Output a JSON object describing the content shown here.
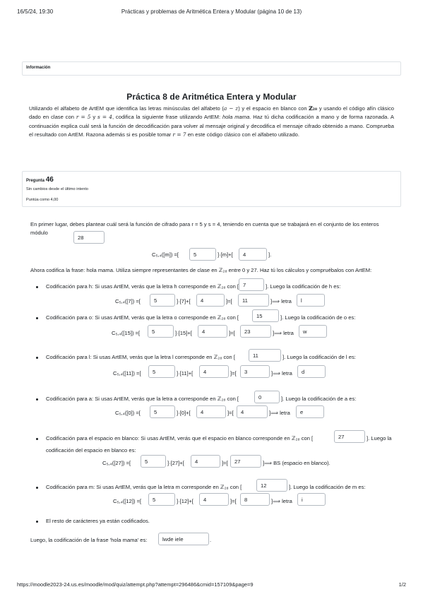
{
  "print_header": {
    "date": "16/5/24, 19:30",
    "title": "Prácticas y problemas de Aritmética Entera y Modular (página 10 de 13)"
  },
  "info": {
    "label": "Información"
  },
  "practice": {
    "title": "Práctica 8 de Aritmética Entera y Modular",
    "intro": [
      "Utilizando el alfabeto de ArtEM que identifica las letras minúsculas del alfabeto (",
      "a − z",
      ") y el espacio en blanco con ",
      "ℤ₂₈",
      " y usando el código afín clásico dado en clase con ",
      "r = 5",
      " y ",
      "s = 4",
      ", codifica la siguiente frase utilizando ArtEM: ",
      "hola mama",
      ". Haz tú dicha codificación a mano y de forma razonada. A continuación explica cuál será la función de decodificación para volver al mensaje original y decodifica el mensaje cifrado obtenido a mano. Comprueba el resultado con ArtEM. Razona además si es posible tomar ",
      "r = 7",
      " en este código clásico con el alfabeto utilizado."
    ]
  },
  "question": {
    "label": "Pregunta",
    "number": "46",
    "state": "Sin cambios desde el último intento",
    "mark": "Puntúa como 4,00"
  },
  "part1": {
    "text": "En primer lugar, debes plantear cuál será la función de cifrado para r = 5 y s = 4, teniendo en cuenta que se trabajará en el conjunto de los enteros módulo",
    "modulus": "28",
    "formula_lhs": "C₅,₄([m]) =[",
    "r_value": "5",
    "mid": "]·[m]+[",
    "s_value": "4",
    "end": "]."
  },
  "part2_text": "Ahora codifica la frase: hola mama. Utiliza siempre representantes de clase en ℤ₂₈ entre 0 y 27. Haz tú los cálculos y compruébalos con ArtEM:",
  "items": [
    {
      "pre": "Codificación para h: Si usas ArtEM, verás que la letra h corresponde en ℤ₂₈ con [",
      "class": "7",
      "post": "]. Luego la codificación de h es:",
      "lhs": "C₅,₄([7]) =[",
      "r": "5",
      "op": "]·[7]+[",
      "s": "4",
      "eq": "]=[",
      "res": "11",
      "tail": "]⟹ letra",
      "letter": "l"
    },
    {
      "pre": "Codificación para o: Si usas ArtEM, verás que la letra o corresponde en ℤ₂₈ con [",
      "class": "15",
      "post": "]. Luego la codificación de o es:",
      "lhs": "C₅,₄([15]) =[",
      "r": "5",
      "op": "]·[15]+[",
      "s": "4",
      "eq": "]=[",
      "res": "23",
      "tail": "]⟹ letra",
      "letter": "w"
    },
    {
      "pre": "Codificación para l: Si usas ArtEM, verás que la letra l corresponde en ℤ₂₈ con [",
      "class": "11",
      "post": "]. Luego la codificación de l es:",
      "lhs": "C₅,₄([11]) =[",
      "r": "5",
      "op": "]·[11]+[",
      "s": "4",
      "eq": "]=[",
      "res": "3",
      "tail": "]⟹ letra",
      "letter": "d"
    },
    {
      "pre": "Codificación para a: Si usas ArtEM, verás que la letra a corresponde en ℤ₂₈ con [",
      "class": "0",
      "post": "]. Luego la codificación de a es:",
      "lhs": "C₅,₄([0]) =[",
      "r": "5",
      "op": "]·[0]+[",
      "s": "4",
      "eq": "]=[",
      "res": "4",
      "tail": "]⟹ letra",
      "letter": "e"
    },
    {
      "pre": "Codificación para el espacio en blanco: Si usas ArtEM, verás que el espacio en blanco corresponde en ℤ₂₈ con [",
      "class": "27",
      "post": "]. Luego la",
      "post2": "codificación del espacio en blanco es:",
      "lhs": "C₅,₄([27]) =[",
      "r": "5",
      "op": "]·[27]+[",
      "s": "4",
      "eq": "]=[",
      "res": "27",
      "tail": "]⟹ BS (espacio en blanco)."
    },
    {
      "pre": "Codificación para m: Si usas ArtEM, verás que la letra m corresponde en ℤ₂₈ con [",
      "class": "12",
      "post": "]. Luego la codificación de m es:",
      "lhs": "C₅,₄([12]) =[",
      "r": "5",
      "op": "]·[12]+[",
      "s": "4",
      "eq": "]=[",
      "res": "8",
      "tail": "]⟹ letra",
      "letter": "i"
    }
  ],
  "rest_text": "El resto de carácteres ya están codificados.",
  "final": {
    "text": "Luego, la codificación de la frase 'hola mama' es:",
    "answer": "lwde iele",
    "dot": "."
  },
  "print_footer": {
    "url": "https://moodle2023-24.us.es/moodle/mod/quiz/attempt.php?attempt=296486&cmid=157109&page=9",
    "pager": "1/2"
  }
}
